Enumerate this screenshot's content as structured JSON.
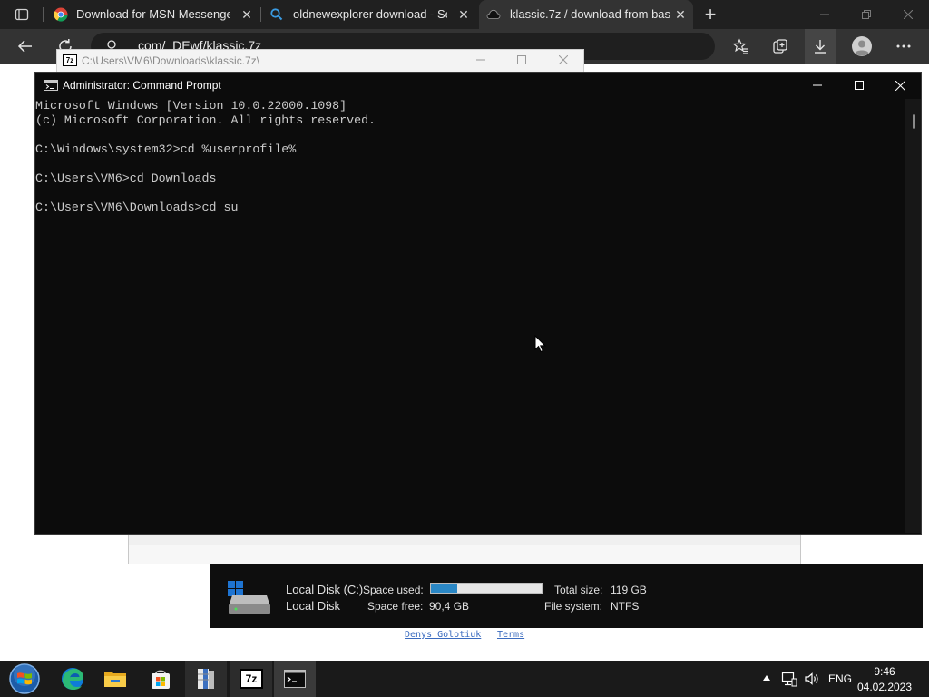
{
  "browser": {
    "tabs": [
      {
        "title": "Download for MSN Messenger |",
        "icon": "chrome-icon"
      },
      {
        "title": "oldnewexplorer download - Sea",
        "icon": "search-icon"
      },
      {
        "title": "klassic.7z / download from bash",
        "icon": "cloud-icon"
      }
    ],
    "close_glyph": "✕",
    "new_tab_glyph": "+",
    "address": "com/_DEwf/klassic.7z"
  },
  "sevenzip": {
    "title": "C:\\Users\\VM6\\Downloads\\klassic.7z\\",
    "icon_label": "7z"
  },
  "cmd": {
    "title": "Administrator: Command Prompt",
    "lines": [
      "Microsoft Windows [Version 10.0.22000.1098]",
      "(c) Microsoft Corporation. All rights reserved.",
      "",
      "C:\\Windows\\system32>cd %userprofile%",
      "",
      "C:\\Users\\VM6>cd Downloads",
      "",
      "C:\\Users\\VM6\\Downloads>cd su"
    ]
  },
  "disk": {
    "name": "Local Disk (C:)",
    "type": "Local Disk",
    "space_used_label": "Space used:",
    "space_free_label": "Space free:",
    "space_free": "90,4 GB",
    "total_size_label": "Total size:",
    "total_size": "119 GB",
    "file_system_label": "File system:",
    "file_system": "NTFS",
    "used_fraction": 0.24,
    "bar_color": "#2a87c5"
  },
  "footer": {
    "author": "Denys Golotiuk",
    "terms": "Terms"
  },
  "taskbar": {
    "lang": "ENG",
    "time": "9:46",
    "date": "04.02.2023",
    "sevenzip_label": "7z"
  }
}
